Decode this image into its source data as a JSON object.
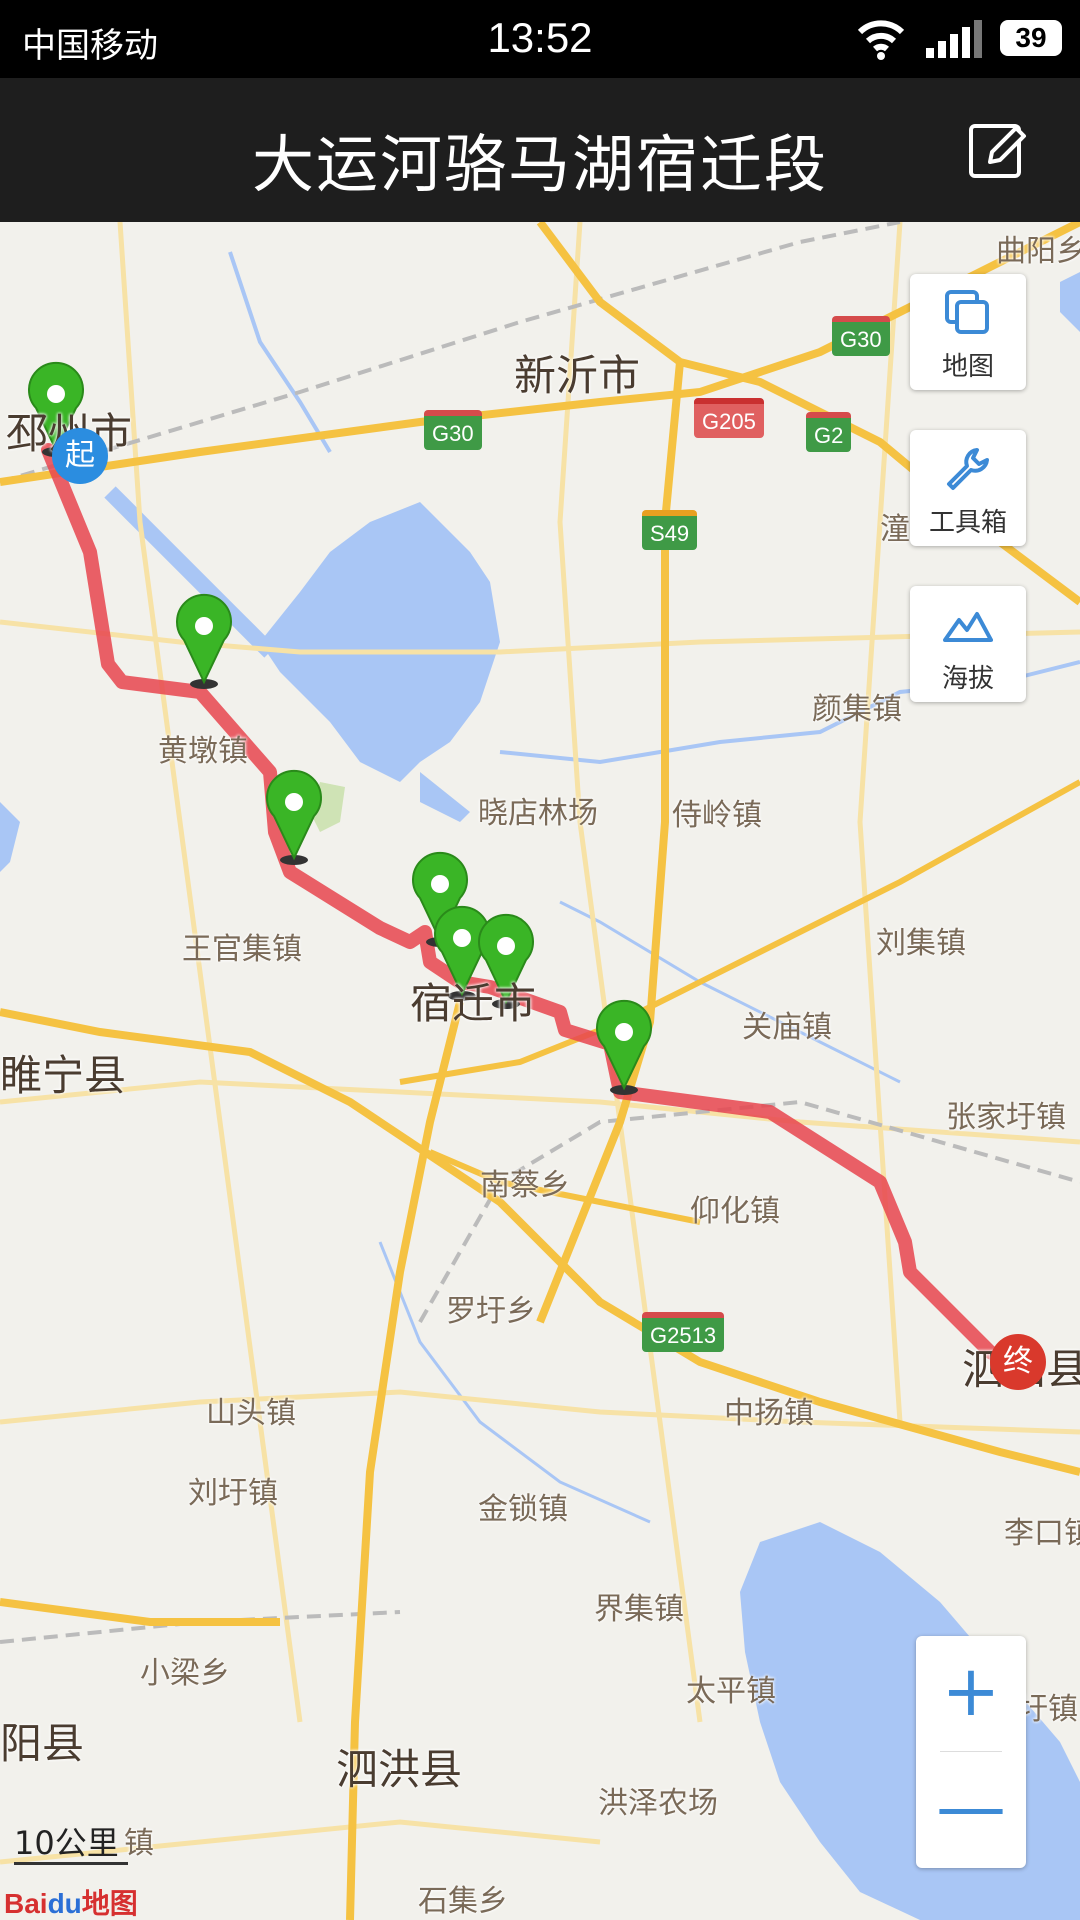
{
  "status_bar": {
    "carrier": "中国移动",
    "time": "13:52",
    "battery": "39"
  },
  "nav": {
    "title": "大运河骆马湖宿迁段"
  },
  "toolbar": {
    "map_label": "地图",
    "tools_label": "工具箱",
    "altitude_label": "海拔"
  },
  "zoom": {
    "in": "+",
    "out": "—"
  },
  "scale_label": "10公里",
  "logo": {
    "left": "Bai",
    "paw": "du",
    "right": "地图"
  },
  "route": {
    "start_label": "起",
    "end_label": "终",
    "color": "#e8454f"
  },
  "map_labels": [
    "曲阳乡",
    "新沂市",
    "邳州市",
    "潼阳",
    "颜集镇",
    "黄墩镇",
    "晓店林场",
    "侍岭镇",
    "王官集镇",
    "刘集镇",
    "宿迁市",
    "关庙镇",
    "睢宁县",
    "张家圩镇",
    "南蔡乡",
    "仰化镇",
    "罗圩乡",
    "泗阳县",
    "山头镇",
    "中扬镇",
    "刘圩镇",
    "金锁镇",
    "李口镇",
    "界集镇",
    "小梁乡",
    "太平镇",
    "裴圩镇",
    "阳县",
    "泗洪县",
    "洪泽农场",
    "镇",
    "石集乡"
  ],
  "road_shields": [
    "G30",
    "G30",
    "G205",
    "G2",
    "S49",
    "G2513"
  ],
  "colors": {
    "water": "#a9c6f5",
    "road_major": "#f5c242",
    "road_minor": "#f7e2a6",
    "land": "#f2f1ec",
    "marker": "#3ab526"
  }
}
